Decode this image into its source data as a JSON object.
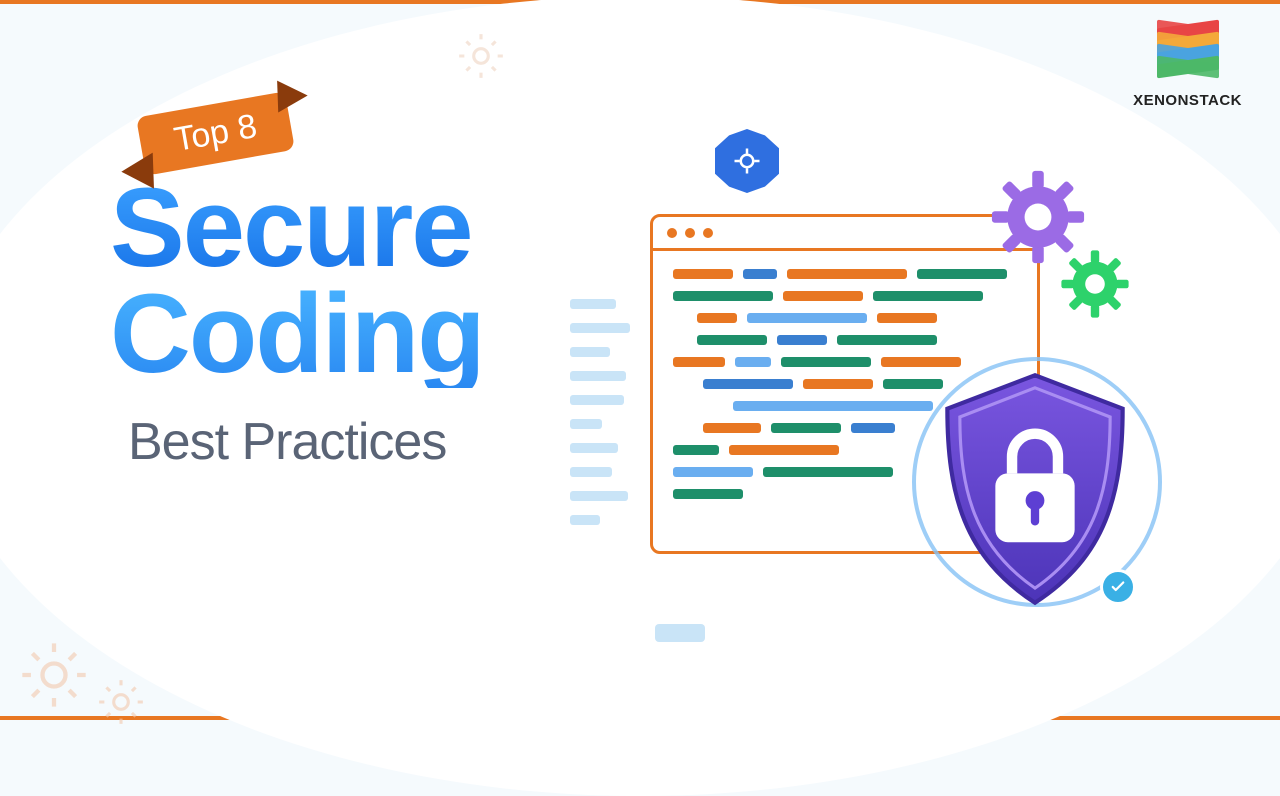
{
  "brand": {
    "name": "XENONSTACK"
  },
  "card": {
    "ribbon": "Top 8",
    "title1": "Secure",
    "title2": "Coding",
    "subtitle": "Best Practices"
  },
  "icons": {
    "blue_badge": "gear-icon",
    "purple_gear": "gear-icon",
    "green_gear": "gear-icon",
    "shield": "lock-shield-icon",
    "check": "check-icon"
  },
  "colors": {
    "accent": "#e87722",
    "blue": "#2f6fe0",
    "purple": "#7a4fd6",
    "green": "#2dd26b",
    "shield_fill": "#5d3fd3"
  }
}
